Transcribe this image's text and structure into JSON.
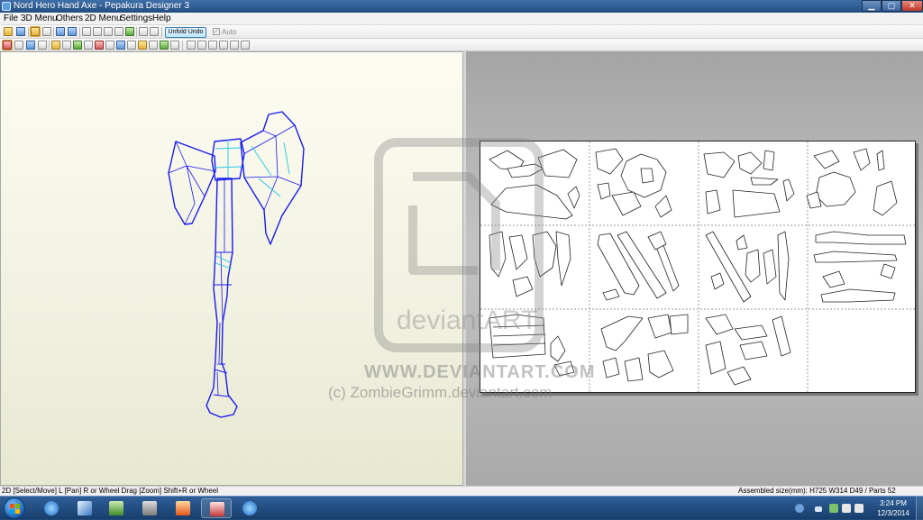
{
  "window": {
    "title": "Nord Hero Hand Axe - Pepakura Designer 3",
    "buttons": {
      "minimize": "▁",
      "maximize": "▢",
      "close": "✕"
    }
  },
  "menu": {
    "items": [
      "File",
      "3D Menu",
      "Others",
      "2D Menu",
      "Settings",
      "Help"
    ]
  },
  "toolbar": {
    "unfold_undo_label": "Unfold Undo",
    "auto_label": "Auto",
    "auto_checked": true
  },
  "views": {
    "left": "3D model view",
    "right": "2D pattern view"
  },
  "watermark": {
    "brand": "deviantART",
    "url": "WWW.DEVIANTART.COM",
    "credit": "(c) ZombieGrimm.deviantart.com"
  },
  "statusbar": {
    "hint": "2D [Select/Move] L [Pan] R or Wheel Drag [Zoom] Shift+R or Wheel",
    "info": "Assembled size(mm): H725 W314 D49 / Parts 52"
  },
  "taskbar": {
    "apps": [
      {
        "name": "internet-explorer",
        "icon": "ie-icon",
        "active": false
      },
      {
        "name": "sketchup",
        "icon": "cube-icon",
        "active": false
      },
      {
        "name": "file-explorer",
        "icon": "folder-icon",
        "active": false
      },
      {
        "name": "media-player",
        "icon": "media-icon",
        "active": false
      },
      {
        "name": "photoshop-elements",
        "icon": "image-editor-icon",
        "active": false
      },
      {
        "name": "pepakura",
        "icon": "pepakura-icon",
        "active": true
      },
      {
        "name": "internet-explorer-2",
        "icon": "ie-icon",
        "active": false
      }
    ],
    "clock": {
      "time": "3:24 PM",
      "date": "12/3/2014"
    }
  },
  "colors": {
    "model_edge": "#1a1aee",
    "model_fold": "#22c8e6",
    "workspace_3d": "#f2f2e2",
    "workspace_2d": "#b4b4b4",
    "taskbar": "#244d80"
  }
}
